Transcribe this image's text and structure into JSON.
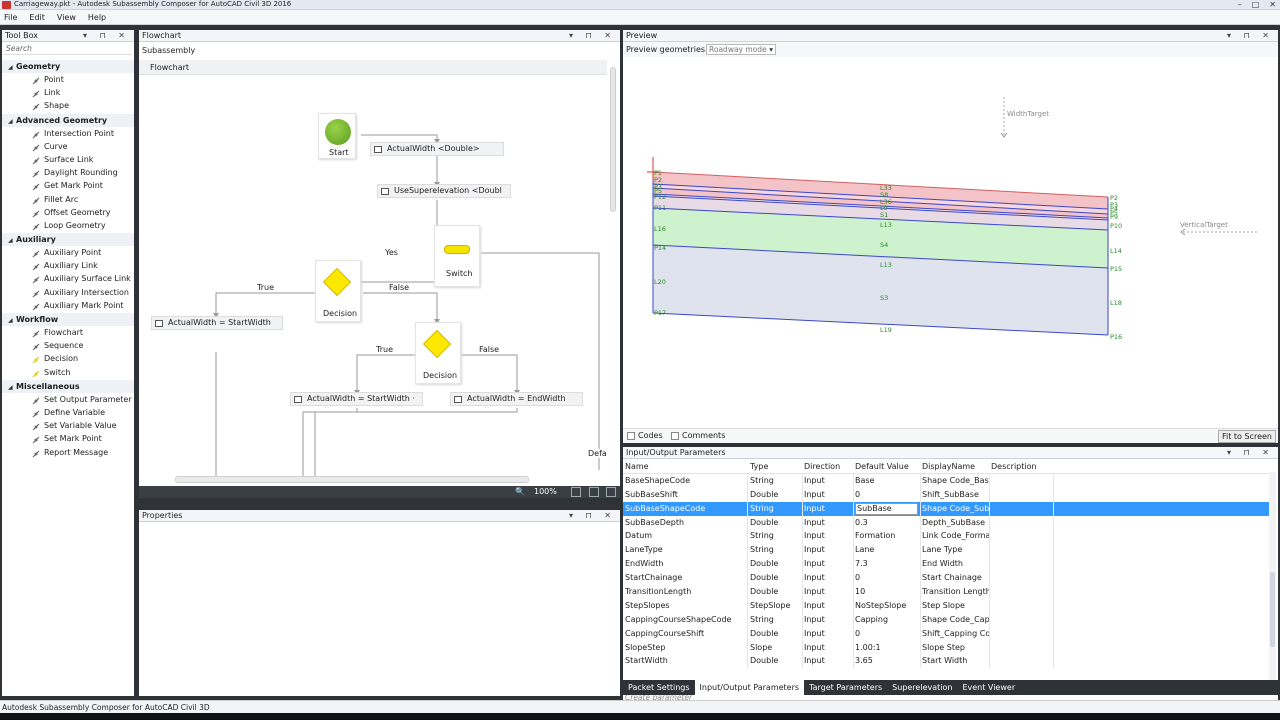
{
  "window": {
    "title": "Carriageway.pkt - Autodesk Subassembly Composer for AutoCAD Civil 3D 2016",
    "min": "–",
    "max": "□",
    "close": "✕"
  },
  "menu": [
    "File",
    "Edit",
    "View",
    "Help"
  ],
  "toolbox": {
    "title": "Tool Box",
    "pin": "▾ ⊓ ✕",
    "search_placeholder": "Search",
    "categories": [
      {
        "label": "Geometry",
        "items": [
          "Point",
          "Link",
          "Shape"
        ]
      },
      {
        "label": "Advanced Geometry",
        "items": [
          "Intersection Point",
          "Curve",
          "Surface Link",
          "Daylight Rounding",
          "Get Mark Point",
          "Fillet Arc",
          "Offset Geometry",
          "Loop Geometry"
        ]
      },
      {
        "label": "Auxiliary",
        "items": [
          "Auxiliary Point",
          "Auxiliary Link",
          "Auxiliary Surface Link",
          "Auxiliary Intersection",
          "Auxiliary Mark Point"
        ]
      },
      {
        "label": "Workflow",
        "items": [
          "Flowchart",
          "Sequence",
          "Decision",
          "Switch"
        ]
      },
      {
        "label": "Miscellaneous",
        "items": [
          "Set Output Parameter",
          "Define Variable",
          "Set Variable Value",
          "Set Mark Point",
          "Report Message"
        ]
      }
    ]
  },
  "flowchart": {
    "title": "Flowchart",
    "pin": "▾ ⊓ ✕",
    "subtitle": "Subassembly",
    "band": "Flowchart",
    "start": "Start",
    "act1": "ActualWidth <Double>",
    "act2": "UseSuperelevation <Doubl",
    "switch": "Switch",
    "yes": "Yes",
    "true1": "True",
    "false1": "False",
    "decision1": "Decision",
    "act3": "ActualWidth = StartWidth",
    "decision2": "Decision",
    "true2": "True",
    "false2": "False",
    "act4": "ActualWidth = StartWidth ·",
    "act5": "ActualWidth = EndWidth",
    "default_lbl": "Defa",
    "zoom": "100%",
    "zoom_icon": "🔍"
  },
  "properties": {
    "title": "Properties",
    "pin": "▾ ⊓ ✕"
  },
  "preview": {
    "title": "Preview",
    "pin": "▾ ⊓ ✕",
    "geom_label": "Preview geometries in",
    "mode": "Roadway mode",
    "width_target": "WidthTarget",
    "vertical_target": "VerticalTarget",
    "codes": "Codes",
    "comments": "Comments",
    "fit": "Fit to Screen",
    "pt_left": [
      "P1",
      "P2",
      "P3",
      "P5",
      "P12",
      "P11",
      "L16",
      "P14",
      "L20",
      "P17"
    ],
    "pt_right": [
      "P2",
      "P3",
      "P4",
      "P5",
      "P9",
      "P10",
      "L14",
      "P15",
      "L18",
      "P16"
    ],
    "link_labels": [
      "L33",
      "S8",
      "L36",
      "L9",
      "S1",
      "L13",
      "S4",
      "L13",
      "S3",
      "L19"
    ]
  },
  "ioparams": {
    "title": "Input/Output Parameters",
    "pin": "▾ ⊓ ✕",
    "columns": [
      "Name",
      "Type",
      "Direction",
      "Default Value",
      "DisplayName",
      "Description"
    ],
    "rows": [
      [
        "BaseShapeCode",
        "String",
        "Input",
        "Base",
        "Shape Code_Base",
        ""
      ],
      [
        "SubBaseShift",
        "Double",
        "Input",
        "0",
        "Shift_SubBase",
        ""
      ],
      [
        "SubBaseShapeCode",
        "String",
        "Input",
        "SubBase",
        "Shape Code_SubB",
        ""
      ],
      [
        "SubBaseDepth",
        "Double",
        "Input",
        "0.3",
        "Depth_SubBase",
        ""
      ],
      [
        "Datum",
        "String",
        "Input",
        "Formation",
        "Link Code_Format",
        ""
      ],
      [
        "LaneType",
        "String",
        "Input",
        "Lane",
        "Lane Type",
        ""
      ],
      [
        "EndWidth",
        "Double",
        "Input",
        "7.3",
        "End Width",
        ""
      ],
      [
        "StartChainage",
        "Double",
        "Input",
        "0",
        "Start Chainage",
        ""
      ],
      [
        "TransitionLength",
        "Double",
        "Input",
        "10",
        "Transition Length",
        ""
      ],
      [
        "StepSlopes",
        "StepSlope",
        "Input",
        "NoStepSlope",
        "Step Slope",
        ""
      ],
      [
        "CappingCourseShapeCode",
        "String",
        "Input",
        "Capping",
        "Shape Code_Capp",
        ""
      ],
      [
        "CappingCourseShift",
        "Double",
        "Input",
        "0",
        "Shift_Capping Cou",
        ""
      ],
      [
        "SlopeStep",
        "Slope",
        "Input",
        "1.00:1",
        "Slope Step",
        ""
      ],
      [
        "StartWidth",
        "Double",
        "Input",
        "3.65",
        "Start Width",
        ""
      ]
    ],
    "selected_row": 2,
    "create": "Create parameter"
  },
  "tabs": [
    "Packet Settings",
    "Input/Output Parameters",
    "Target Parameters",
    "Superelevation",
    "Event Viewer"
  ],
  "active_tab": 1,
  "status": "Autodesk Subassembly Composer for AutoCAD Civil 3D",
  "colors": {
    "selection": "#3399ff",
    "shape_red": "#f4c3c8",
    "shape_green": "#cdf2cd",
    "shape_blue": "#dfe3ee",
    "link": "#3a47c9"
  }
}
